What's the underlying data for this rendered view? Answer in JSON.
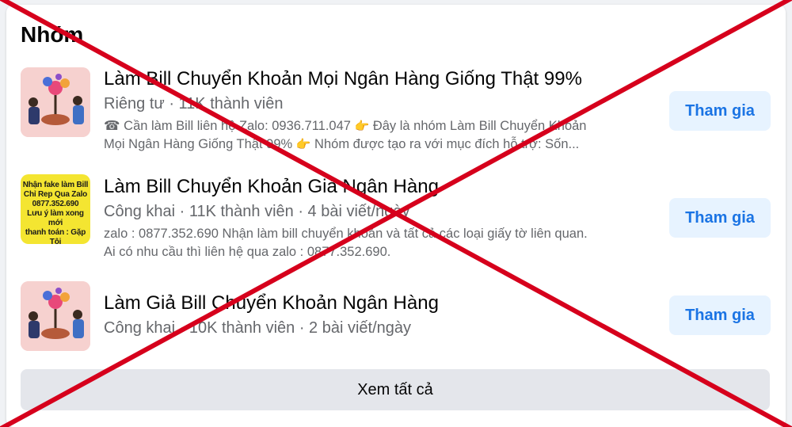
{
  "section": {
    "title": "Nhóm"
  },
  "groups": [
    {
      "name": "Làm Bill Chuyển Khoản Mọi Ngân Hàng Giống Thật 99%",
      "meta": "Riêng tư · 11K thành viên",
      "desc_line1_a": "Cần làm Bill liên hệ Zalo: 0936.711.047",
      "desc_line1_b": "Đây là nhóm Làm Bill Chuyển Khoản",
      "desc_line2_a": "Mọi Ngân Hàng Giống Thật 99%",
      "desc_line2_b": "Nhóm được tạo ra với mục đích hỗ trợ: Sốn...",
      "join_label": "Tham gia"
    },
    {
      "name": "Làm Bill Chuyển Khoản Giả Ngân Hàng",
      "meta": "Công khai · 11K thành viên · 4 bài viết/ngày",
      "desc_line1": "zalo : 0877.352.690 Nhận làm bill chuyển khoản và tất cả các loại giấy tờ liên quan.",
      "desc_line2": "Ai có nhu cầu thì liên hệ qua zalo : 0877.352.690.",
      "thumb_text": "Nhận fake làm Bill\nChỉ Rep Qua Zalo\n0877.352.690\nLưu ý làm xong mới\nthanh toán : Gặp Tôi",
      "join_label": "Tham gia"
    },
    {
      "name": "Làm Giả Bill Chuyển Khoản Ngân Hàng",
      "meta": "Công khai · 10K thành viên · 2 bài viết/ngày",
      "join_label": "Tham gia"
    }
  ],
  "see_all_label": "Xem tất cả",
  "icons": {
    "phone": "phone-icon",
    "pointing_hand": "pointing-hand-icon"
  },
  "colors": {
    "join_bg": "#e7f3ff",
    "join_text": "#1b74e4",
    "overlay_x": "#d6001c"
  }
}
